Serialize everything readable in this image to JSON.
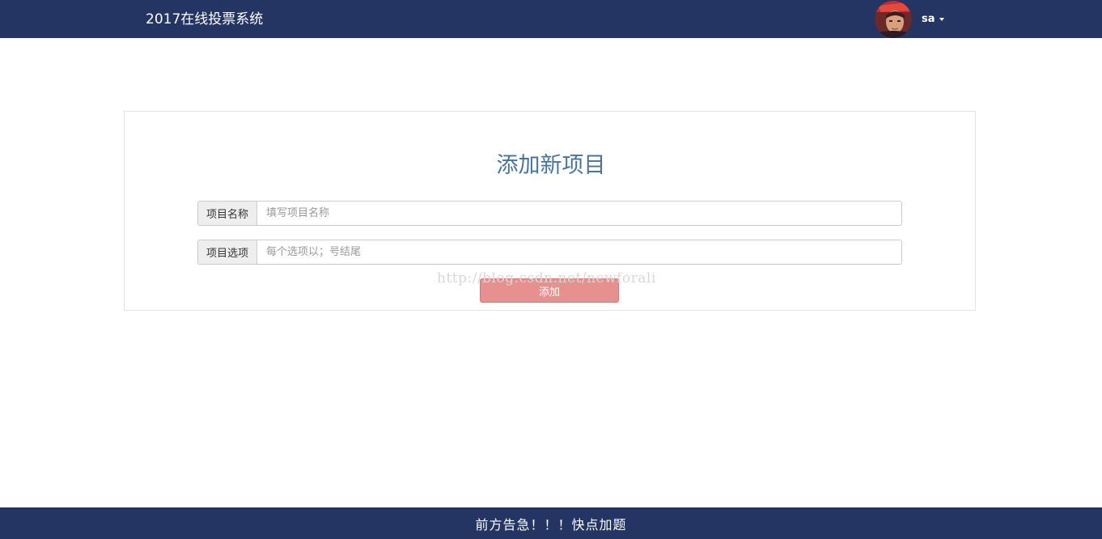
{
  "navbar": {
    "brand": "2017在线投票系统",
    "username": "sa"
  },
  "form": {
    "title": "添加新项目",
    "name_label": "项目名称",
    "name_placeholder": "填写项目名称",
    "options_label": "项目选项",
    "options_placeholder": "每个选项以；号结尾",
    "submit_label": "添加"
  },
  "watermark": "http://blog.csdn.net/newforali",
  "footer": {
    "text": "前方告急！！！快点加题"
  },
  "colors": {
    "nav_background": "#243564",
    "title": "#47739c",
    "button": "#e07878"
  },
  "icons": {
    "avatar": "user-avatar",
    "caret": "caret-down-icon"
  }
}
